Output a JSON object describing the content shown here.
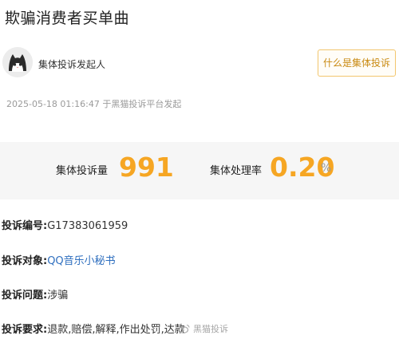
{
  "page": {
    "title": "欺骗消费者买单曲"
  },
  "initiator": {
    "label": "集体投诉发起人",
    "avatar_icon": "cat-avatar-icon"
  },
  "what_button": {
    "label": "什么是集体投诉"
  },
  "meta": {
    "text": "2025-05-18 01:16:47 于黑猫投诉平台发起"
  },
  "stats": {
    "count_label": "集体投诉量",
    "count_value": "991",
    "rate_label": "集体处理率",
    "rate_value": "0.20",
    "rate_unit": "%",
    "accent_color": "#f6a623"
  },
  "fields": {
    "number": {
      "label": "投诉编号:",
      "value": "G17383061959"
    },
    "target": {
      "label": "投诉对象:",
      "value": "QQ音乐小秘书"
    },
    "issue": {
      "label": "投诉问题:",
      "value": "涉骗"
    },
    "demand": {
      "label": "投诉要求:",
      "value": "退款,赔偿,解释,作出处罚,达款"
    }
  },
  "watermark": {
    "text": "黑猫投诉"
  }
}
